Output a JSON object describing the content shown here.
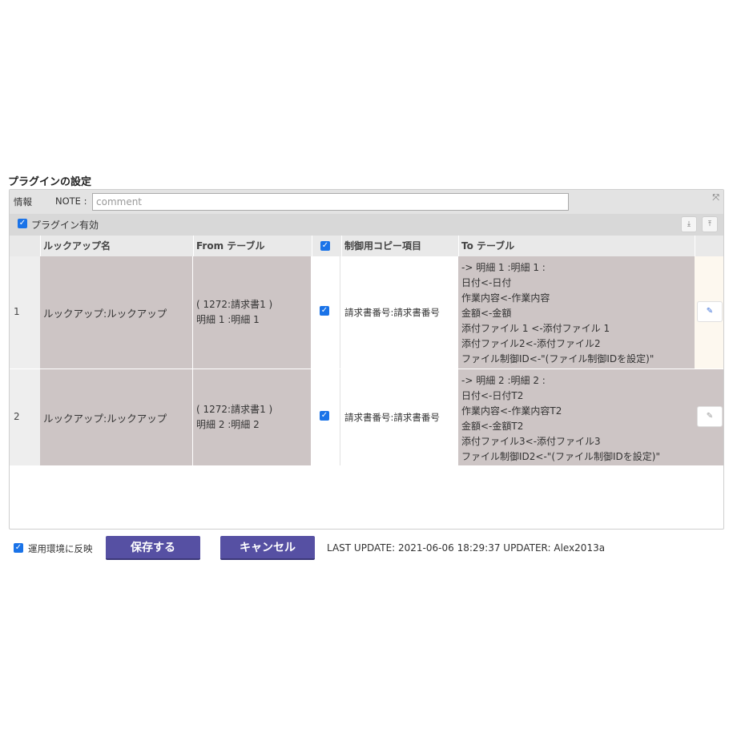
{
  "section_title": "プラグインの設定",
  "info": {
    "label": "情報",
    "note_label": "NOTE :",
    "note_placeholder": "comment",
    "note_value": ""
  },
  "plugin_enabled": {
    "label": "プラグイン有効",
    "checked": true
  },
  "table": {
    "headers": {
      "lookup_name": "ルックアップ名",
      "from_table": "From テーブル",
      "control_copy": "制御用コピー項目",
      "to_table": "To テーブル"
    },
    "rows": [
      {
        "num": "1",
        "lookup_name": "ルックアップ:ルックアップ",
        "from_line1": "( 1272:請求書1 )",
        "from_line2": "明細 1 :明細 1",
        "checked": true,
        "control_copy": "請求書番号:請求書番号",
        "to_lines": [
          "-> 明細 1 :明細 1 :",
          "日付<-日付",
          "作業内容<-作業内容",
          "金額<-金額",
          "添付ファイル 1 <-添付ファイル 1",
          "添付ファイル2<-添付ファイル2",
          "ファイル制御ID<-\"(ファイル制御IDを設定)\""
        ]
      },
      {
        "num": "2",
        "lookup_name": "ルックアップ:ルックアップ",
        "from_line1": "( 1272:請求書1 )",
        "from_line2": "明細 2 :明細 2",
        "checked": true,
        "control_copy": "請求書番号:請求書番号",
        "to_lines": [
          "-> 明細 2 :明細 2 :",
          "日付<-日付T2",
          "作業内容<-作業内容T2",
          "金額<-金額T2",
          "添付ファイル3<-添付ファイル3",
          "ファイル制御ID2<-\"(ファイル制御IDを設定)\""
        ]
      }
    ]
  },
  "footer": {
    "deploy_label": "運用環境に反映",
    "deploy_checked": true,
    "save_label": "保存する",
    "cancel_label": "キャンセル",
    "last_update": "LAST UPDATE: 2021-06-06 18:29:37 UPDATER: Alex2013a"
  },
  "colors": {
    "primary_button": "#5650a3",
    "checkbox": "#1a73e8",
    "row_fill": "#cdc5c5",
    "edit_column_row1": "#fdf8ef"
  }
}
